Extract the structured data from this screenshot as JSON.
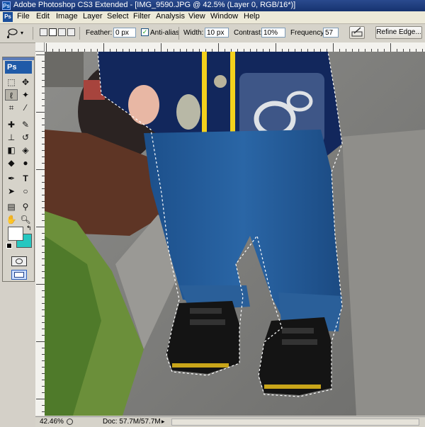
{
  "window": {
    "app_icon": "Ps",
    "title": "Adobe Photoshop CS3 Extended - [IMG_9590.JPG @ 42.5% (Layer 0, RGB/16*)]"
  },
  "menu": {
    "logo": "Ps",
    "items": [
      "File",
      "Edit",
      "Image",
      "Layer",
      "Select",
      "Filter",
      "Analysis",
      "View",
      "Window",
      "Help"
    ]
  },
  "options": {
    "tool_icon": "lasso-icon",
    "feather_label": "Feather:",
    "feather_value": "0 px",
    "antialias_label": "Anti-alias",
    "antialias_checked": true,
    "width_label": "Width:",
    "width_value": "10 px",
    "contrast_label": "Contrast:",
    "contrast_value": "10%",
    "frequency_label": "Frequency:",
    "frequency_value": "57",
    "refine_edge_label": "Refine Edge..."
  },
  "toolbox": {
    "logo": "Ps",
    "foreground_color": "#ffffff",
    "background_color": "#26c7c0"
  },
  "status": {
    "zoom": "42.46%",
    "doc": "Doc: 57.7M/57.7M"
  }
}
